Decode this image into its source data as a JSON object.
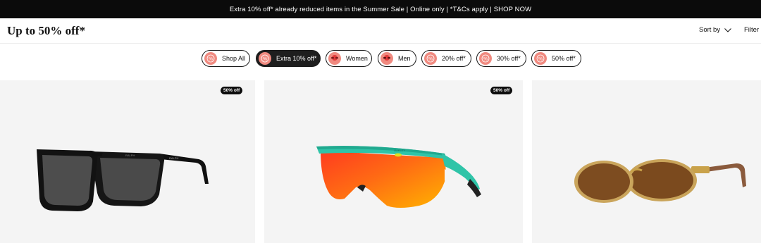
{
  "promo": {
    "text": "Extra 10% off* already reduced items in the Summer Sale | Online only | *T&Cs apply | SHOP NOW"
  },
  "header": {
    "title": "Up to 50% off*",
    "sort_label": "Sort by",
    "filter_label": "Filter b"
  },
  "chips": [
    {
      "label": "Shop All",
      "icon": "percent-icon",
      "active": false
    },
    {
      "label": "Extra 10% off*",
      "icon": "percent-icon",
      "active": true
    },
    {
      "label": "Women",
      "icon": "women-icon",
      "active": false
    },
    {
      "label": "Men",
      "icon": "men-icon",
      "active": false
    },
    {
      "label": "20% off*",
      "icon": "percent-icon",
      "active": false
    },
    {
      "label": "30% off*",
      "icon": "percent-icon",
      "active": false
    },
    {
      "label": "50% off*",
      "icon": "percent-icon",
      "active": false
    }
  ],
  "products": [
    {
      "badge": "50% off",
      "image": "black-square-sunglasses"
    },
    {
      "badge": "50% off",
      "image": "teal-sport-shield-sunglasses"
    },
    {
      "badge": "",
      "image": "gold-oval-sunglasses"
    }
  ],
  "colors": {
    "promo_bg": "#0b0b0b",
    "chip_active": "#1e1e1e",
    "chip_icon": "#f08a80",
    "card_bg": "#f4f4f4"
  }
}
